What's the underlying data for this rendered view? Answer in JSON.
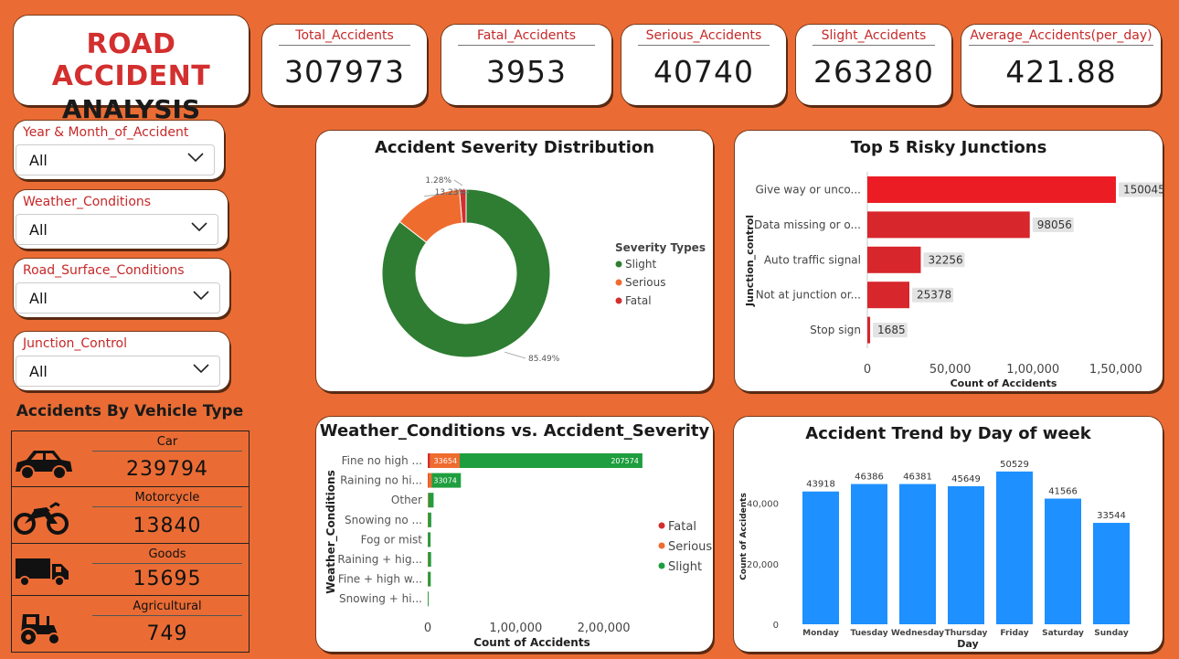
{
  "title": {
    "line1": "ROAD ACCIDENT",
    "line2": "ANALYSIS"
  },
  "kpis": [
    {
      "label": "Total_Accidents",
      "value": "307973"
    },
    {
      "label": "Fatal_Accidents",
      "value": "3953"
    },
    {
      "label": "Serious_Accidents",
      "value": "40740"
    },
    {
      "label": "Slight_Accidents",
      "value": "263280"
    },
    {
      "label": "Average_Accidents(per_day)",
      "value": "421.88"
    }
  ],
  "slicers": [
    {
      "label": "Year & Month_of_Accident",
      "value": "All"
    },
    {
      "label": "Weather_Conditions",
      "value": "All"
    },
    {
      "label": "Road_Surface_Conditions",
      "value": "All"
    },
    {
      "label": "Junction_Control",
      "value": "All"
    }
  ],
  "vehicles": {
    "title": "Accidents By Vehicle Type",
    "items": [
      {
        "name": "Car",
        "value": "239794",
        "icon": "car-icon"
      },
      {
        "name": "Motorcycle",
        "value": "13840",
        "icon": "motorcycle-icon"
      },
      {
        "name": "Goods",
        "value": "15695",
        "icon": "truck-icon"
      },
      {
        "name": "Agricultural",
        "value": "749",
        "icon": "tractor-icon"
      }
    ]
  },
  "colors": {
    "background": "#EA6C34",
    "slight": "#2E7D32",
    "serious": "#EF6C2F",
    "fatal": "#D32F2F",
    "bar_red": "#E31E24",
    "bar_blue": "#1E90FF"
  },
  "chart_data": [
    {
      "type": "pie",
      "title": "Accident Severity Distribution",
      "legend_title": "Severity Types",
      "categories": [
        "Slight",
        "Serious",
        "Fatal"
      ],
      "values": [
        85.49,
        13.23,
        1.28
      ],
      "labels": [
        "85.49%",
        "13.23%",
        "1.28%"
      ],
      "colors": [
        "#2E7D32",
        "#EF6C2F",
        "#D32F2F"
      ]
    },
    {
      "type": "bar",
      "orientation": "horizontal",
      "title": "Top 5 Risky Junctions",
      "categories": [
        "Give way or unco...",
        "Data missing or o...",
        "Auto traffic signal",
        "Not at junction or...",
        "Stop sign"
      ],
      "values": [
        150045,
        98056,
        32256,
        25378,
        1685
      ],
      "xlabel": "Count of Accidents",
      "ylabel": "Junction_control",
      "xticks": [
        "0",
        "50,000",
        "1,00,000",
        "1,50,000"
      ],
      "xlim": [
        0,
        160000
      ]
    },
    {
      "type": "bar",
      "orientation": "horizontal",
      "stacked": true,
      "title": "Weather_Conditions vs. Accident_Severity",
      "categories": [
        "Fine no high ...",
        "Raining no hi...",
        "Other",
        "Snowing no ...",
        "Fog or mist",
        "Raining + hig...",
        "Fine + high w...",
        "Snowing + hi..."
      ],
      "series": [
        {
          "name": "Fatal",
          "values": [
            2700,
            400,
            60,
            30,
            30,
            40,
            30,
            10
          ]
        },
        {
          "name": "Serious",
          "values": [
            33654,
            4200,
            800,
            500,
            300,
            500,
            400,
            100
          ]
        },
        {
          "name": "Slight",
          "values": [
            207574,
            33074,
            5800,
            3500,
            2900,
            3300,
            3000,
            900
          ]
        }
      ],
      "data_labels": {
        "Serious": [
          "33654"
        ],
        "Slight": [
          "207574",
          "33074"
        ]
      },
      "xlabel": "Count of Accidents",
      "ylabel": "Weather_Conditions",
      "xticks": [
        "0",
        "1,00,000",
        "2,00,000"
      ],
      "xlim": [
        0,
        270000
      ],
      "legend": [
        "Fatal",
        "Serious",
        "Slight"
      ]
    },
    {
      "type": "bar",
      "title": "Accident Trend by Day of week",
      "categories": [
        "Monday",
        "Tuesday",
        "Wednesday",
        "Thursday",
        "Friday",
        "Saturday",
        "Sunday"
      ],
      "values": [
        43918,
        46386,
        46381,
        45649,
        50529,
        41566,
        33544
      ],
      "xlabel": "Day",
      "ylabel": "Count of Accidents",
      "yticks": [
        "0",
        "20,000",
        "40,000"
      ],
      "ylim": [
        0,
        52000
      ]
    }
  ]
}
